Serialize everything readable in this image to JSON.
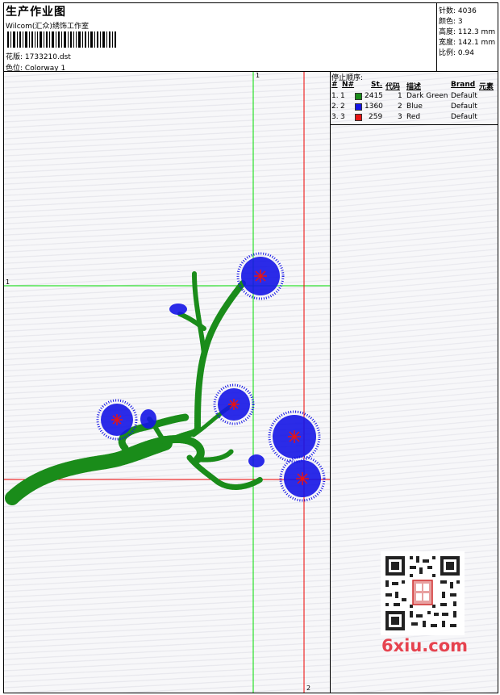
{
  "header": {
    "title": "生产作业图",
    "subtitle": "Wilcom(汇众)绣饰工作室",
    "file_label": "花版:",
    "file_name": "1733210.dst",
    "colorway_label": "色位:",
    "colorway_name": "Colorway 1"
  },
  "stats": {
    "stitches_label": "针数:",
    "stitches": "4036",
    "colors_label": "颜色:",
    "colors": "3",
    "height_label": "高度:",
    "height": "112.3 mm",
    "width_label": "宽度:",
    "width": "142.1 mm",
    "scale_label": "比例:",
    "scale": "0.94"
  },
  "guides": {
    "green_v_label": "1",
    "green_h_label": "1",
    "red_v_label": "2"
  },
  "sequence": {
    "title": "停止顺序:",
    "headers": [
      "#",
      "N#",
      "St.",
      "代码",
      "描述",
      "Brand",
      "元素"
    ],
    "rows": [
      {
        "num": "1.",
        "n": "1",
        "color": "#1a8c1a",
        "stitches": "2415",
        "code": "1",
        "desc": "Dark Green",
        "brand": "Default"
      },
      {
        "num": "2.",
        "n": "2",
        "color": "#1414e6",
        "stitches": "1360",
        "code": "2",
        "desc": "Blue",
        "brand": "Default"
      },
      {
        "num": "3.",
        "n": "3",
        "color": "#e61414",
        "stitches": "259",
        "code": "3",
        "desc": "Red",
        "brand": "Default"
      }
    ]
  },
  "watermark": {
    "brand_text": "6xiu.com"
  },
  "colors": {
    "green_thread": "#1a8c1a",
    "blue_thread": "#1414e6",
    "red_thread": "#e61414",
    "guide_green": "#00dd00",
    "guide_red": "#ee0000",
    "brand_red": "#e6434f"
  }
}
